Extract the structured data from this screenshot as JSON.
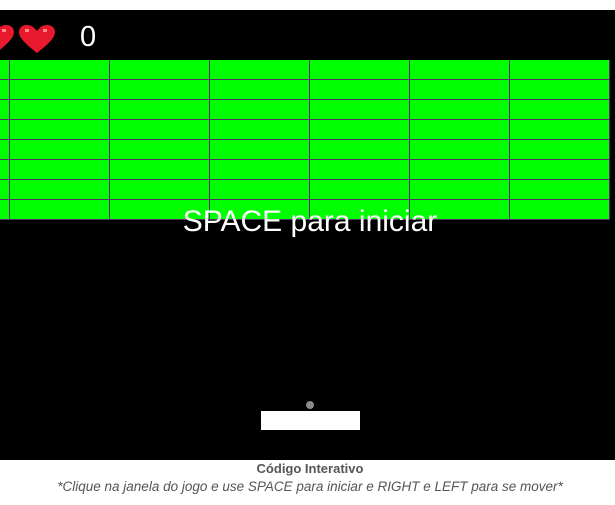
{
  "game": {
    "score": "0",
    "lives": 2,
    "start_message": "SPACE para iniciar",
    "colors": {
      "background": "#000000",
      "brick": "#00ff00",
      "brick_border": "#5a2a6a",
      "heart": "#e8192c",
      "paddle": "#ffffff",
      "ball": "#8a8a8a",
      "text": "#ffffff"
    },
    "hud_icons": [
      "heart-icon",
      "heart-icon"
    ],
    "bricks": {
      "rows": 8,
      "columns": 7
    }
  },
  "caption": {
    "title": "Código Interativo",
    "instructions": "*Clique na janela do jogo e use SPACE para iniciar e RIGHT e LEFT para se mover*"
  }
}
